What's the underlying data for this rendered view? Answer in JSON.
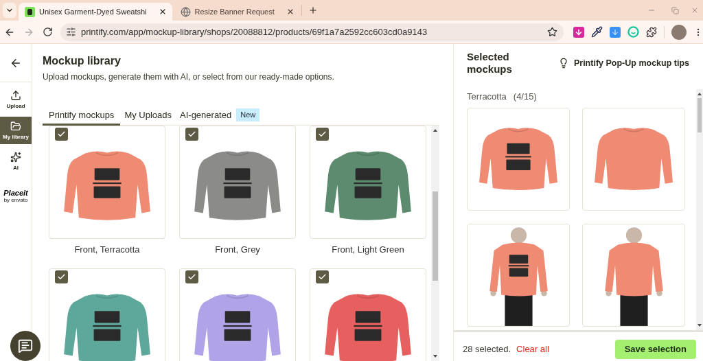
{
  "browser": {
    "tabs": [
      {
        "title": "Unisex Garment-Dyed Sweatshi",
        "kind": "brand",
        "selected": true
      },
      {
        "title": "Resize Banner Request",
        "kind": "generic",
        "selected": false
      }
    ],
    "url": "printify.com/app/mockup-library/shops/20088812/products/69f1a7a2592cc603cd0a9143"
  },
  "sidebar": {
    "items": [
      {
        "label": "Upload",
        "kind": "upload",
        "selected": false
      },
      {
        "label": "My library",
        "kind": "library",
        "selected": true
      },
      {
        "label": "AI",
        "kind": "ai",
        "selected": false
      }
    ],
    "logo": {
      "name": "Placeit",
      "byline": "by envato"
    }
  },
  "library": {
    "title": "Mockup library",
    "subtitle": "Upload mockups, generate them with AI, or select from our ready-made options.",
    "tabs": [
      {
        "label": "Printify mockups",
        "selected": true
      },
      {
        "label": "My Uploads",
        "selected": false
      },
      {
        "label": "AI-generated",
        "selected": false,
        "badge": "New"
      }
    ],
    "mockups": [
      {
        "label": "Front, Terracotta",
        "checked": true,
        "color": "#ef8a73"
      },
      {
        "label": "Front, Grey",
        "checked": true,
        "color": "#8b8b89"
      },
      {
        "label": "Front, Light Green",
        "checked": true,
        "color": "#5d8b70"
      },
      {
        "checked": true,
        "color": "#5ea89b"
      },
      {
        "checked": true,
        "color": "#b0a3e8"
      },
      {
        "checked": true,
        "color": "#e6605f"
      }
    ]
  },
  "selected_panel": {
    "title": "Selected mockups",
    "tips_link": "Printify Pop-Up mockup tips",
    "groups": [
      {
        "name": "Terracotta",
        "count": "(4/15)",
        "color": "#ef8a73",
        "items": [
          {
            "kind": "front"
          },
          {
            "kind": "back"
          },
          {
            "kind": "model-front"
          },
          {
            "kind": "model-back"
          }
        ]
      }
    ],
    "summary": "28 selected.",
    "clear_link": "Clear all",
    "save_button": "Save selection"
  }
}
